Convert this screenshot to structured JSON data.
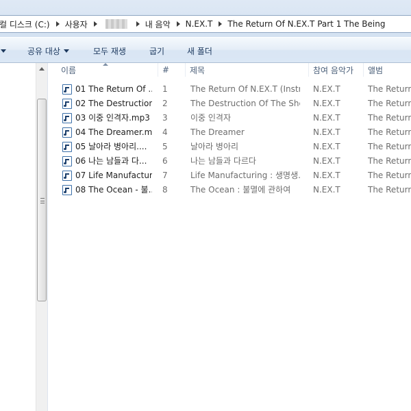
{
  "breadcrumb": [
    {
      "label": "컬 디스크 (C:)"
    },
    {
      "label": "사용자"
    },
    {
      "label": ""
    },
    {
      "label": "내 음악"
    },
    {
      "label": "N.EX.T"
    },
    {
      "label": "The Return Of N.EX.T Part 1 The Being"
    }
  ],
  "toolbar": {
    "share_label": "공유 대상",
    "play_all_label": "모두 재생",
    "burn_label": "굽기",
    "new_folder_label": "새 폴더"
  },
  "columns": {
    "name": "이름",
    "number": "#",
    "title": "제목",
    "artist": "참여 음악가",
    "album": "앨범"
  },
  "files": [
    {
      "name": "01 The Return Of ...",
      "number": "1",
      "title": "The Return Of N.EX.T (Instru...",
      "artist": "N.EX.T",
      "album": "The Return Of N.EX.T"
    },
    {
      "name": "02 The Destruction...",
      "number": "2",
      "title": "The Destruction Of The Shell...",
      "artist": "N.EX.T",
      "album": "The Return Of N.EX.T"
    },
    {
      "name": "03 이중 인격자.mp3",
      "number": "3",
      "title": "이중 인격자",
      "artist": "N.EX.T",
      "album": "The Return Of N.EX.T"
    },
    {
      "name": "04 The Dreamer.m...",
      "number": "4",
      "title": "The Dreamer",
      "artist": "N.EX.T",
      "album": "The Return Of N.EX.T"
    },
    {
      "name": "05 날아라 병아리....",
      "number": "5",
      "title": "날아라 병아리",
      "artist": "N.EX.T",
      "album": "The Return Of N.EX.T"
    },
    {
      "name": "06 나는 남들과 다...",
      "number": "6",
      "title": "나는 남들과 다르다",
      "artist": "N.EX.T",
      "album": "The Return Of N.EX.T"
    },
    {
      "name": "07 Life Manufactur...",
      "number": "7",
      "title": "Life Manufacturing : 생명생...",
      "artist": "N.EX.T",
      "album": "The Return Of N.EX.T"
    },
    {
      "name": "08 The Ocean - 불...",
      "number": "8",
      "title": "The Ocean : 불멸에 관하여",
      "artist": "N.EX.T",
      "album": "The Return Of N.EX.T"
    }
  ],
  "icons": {
    "file": "audio-file-icon",
    "breadcrumb_separator": "chevron-right-icon",
    "dropdown": "caret-down-icon"
  },
  "colors": {
    "toolbar_text": "#1e3a5f",
    "header_text": "#4c607a",
    "secondary_text": "#6d6d6d"
  }
}
